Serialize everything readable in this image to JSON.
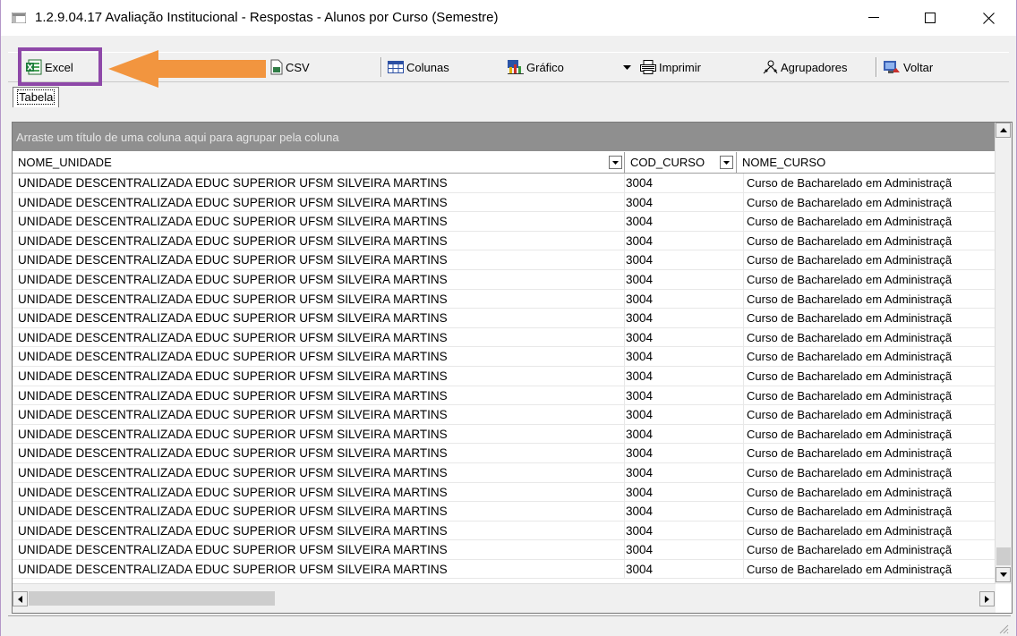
{
  "window": {
    "title": "1.2.9.04.17 Avaliação Institucional - Respostas - Alunos por Curso (Semestre)"
  },
  "toolbar": {
    "excel": "Excel",
    "csv": "CSV",
    "colunas": "Colunas",
    "grafico": "Gráfico",
    "imprimir": "Imprimir",
    "agrupadores": "Agrupadores",
    "voltar": "Voltar"
  },
  "tabs": {
    "tabela": "Tabela"
  },
  "grid": {
    "group_hint": "Arraste um título de uma coluna aqui para agrupar pela coluna",
    "columns": [
      "NOME_UNIDADE",
      "COD_CURSO",
      "NOME_CURSO"
    ],
    "rows": [
      [
        "UNIDADE DESCENTRALIZADA EDUC SUPERIOR UFSM SILVEIRA MARTINS",
        "3004",
        "Curso de Bacharelado em Administraçã"
      ],
      [
        "UNIDADE DESCENTRALIZADA EDUC SUPERIOR UFSM SILVEIRA MARTINS",
        "3004",
        "Curso de Bacharelado em Administraçã"
      ],
      [
        "UNIDADE DESCENTRALIZADA EDUC SUPERIOR UFSM SILVEIRA MARTINS",
        "3004",
        "Curso de Bacharelado em Administraçã"
      ],
      [
        "UNIDADE DESCENTRALIZADA EDUC SUPERIOR UFSM SILVEIRA MARTINS",
        "3004",
        "Curso de Bacharelado em Administraçã"
      ],
      [
        "UNIDADE DESCENTRALIZADA EDUC SUPERIOR UFSM SILVEIRA MARTINS",
        "3004",
        "Curso de Bacharelado em Administraçã"
      ],
      [
        "UNIDADE DESCENTRALIZADA EDUC SUPERIOR UFSM SILVEIRA MARTINS",
        "3004",
        "Curso de Bacharelado em Administraçã"
      ],
      [
        "UNIDADE DESCENTRALIZADA EDUC SUPERIOR UFSM SILVEIRA MARTINS",
        "3004",
        "Curso de Bacharelado em Administraçã"
      ],
      [
        "UNIDADE DESCENTRALIZADA EDUC SUPERIOR UFSM SILVEIRA MARTINS",
        "3004",
        "Curso de Bacharelado em Administraçã"
      ],
      [
        "UNIDADE DESCENTRALIZADA EDUC SUPERIOR UFSM SILVEIRA MARTINS",
        "3004",
        "Curso de Bacharelado em Administraçã"
      ],
      [
        "UNIDADE DESCENTRALIZADA EDUC SUPERIOR UFSM SILVEIRA MARTINS",
        "3004",
        "Curso de Bacharelado em Administraçã"
      ],
      [
        "UNIDADE DESCENTRALIZADA EDUC SUPERIOR UFSM SILVEIRA MARTINS",
        "3004",
        "Curso de Bacharelado em Administraçã"
      ],
      [
        "UNIDADE DESCENTRALIZADA EDUC SUPERIOR UFSM SILVEIRA MARTINS",
        "3004",
        "Curso de Bacharelado em Administraçã"
      ],
      [
        "UNIDADE DESCENTRALIZADA EDUC SUPERIOR UFSM SILVEIRA MARTINS",
        "3004",
        "Curso de Bacharelado em Administraçã"
      ],
      [
        "UNIDADE DESCENTRALIZADA EDUC SUPERIOR UFSM SILVEIRA MARTINS",
        "3004",
        "Curso de Bacharelado em Administraçã"
      ],
      [
        "UNIDADE DESCENTRALIZADA EDUC SUPERIOR UFSM SILVEIRA MARTINS",
        "3004",
        "Curso de Bacharelado em Administraçã"
      ],
      [
        "UNIDADE DESCENTRALIZADA EDUC SUPERIOR UFSM SILVEIRA MARTINS",
        "3004",
        "Curso de Bacharelado em Administraçã"
      ],
      [
        "UNIDADE DESCENTRALIZADA EDUC SUPERIOR UFSM SILVEIRA MARTINS",
        "3004",
        "Curso de Bacharelado em Administraçã"
      ],
      [
        "UNIDADE DESCENTRALIZADA EDUC SUPERIOR UFSM SILVEIRA MARTINS",
        "3004",
        "Curso de Bacharelado em Administraçã"
      ],
      [
        "UNIDADE DESCENTRALIZADA EDUC SUPERIOR UFSM SILVEIRA MARTINS",
        "3004",
        "Curso de Bacharelado em Administraçã"
      ],
      [
        "UNIDADE DESCENTRALIZADA EDUC SUPERIOR UFSM SILVEIRA MARTINS",
        "3004",
        "Curso de Bacharelado em Administraçã"
      ],
      [
        "UNIDADE DESCENTRALIZADA EDUC SUPERIOR UFSM SILVEIRA MARTINS",
        "3004",
        "Curso de Bacharelado em Administraçã"
      ]
    ]
  },
  "colors": {
    "highlight": "#8e48a8",
    "arrow": "#f2953f",
    "group_panel": "#8f8f8f"
  },
  "icons": [
    "app-icon",
    "minimize-icon",
    "maximize-icon",
    "close-icon",
    "excel-icon",
    "csv-icon",
    "columns-icon",
    "chart-icon",
    "dropdown-arrow-icon",
    "printer-icon",
    "grouping-icon",
    "back-icon",
    "scroll-up-icon",
    "scroll-down-icon",
    "scroll-left-icon",
    "scroll-right-icon",
    "column-filter-icon"
  ]
}
